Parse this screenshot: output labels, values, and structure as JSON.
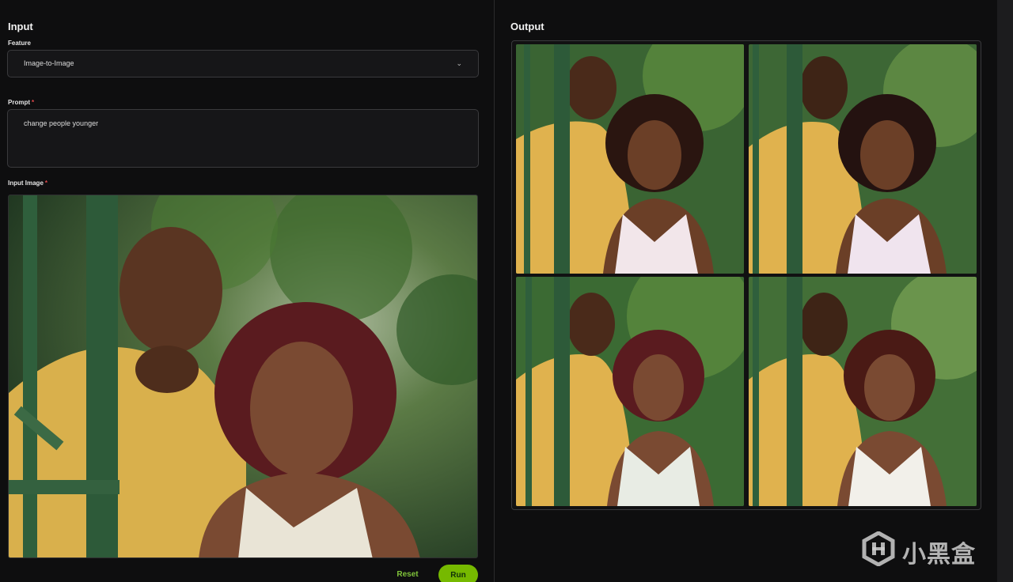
{
  "input": {
    "title": "Input",
    "feature": {
      "label": "Feature",
      "value": "Image-to-Image"
    },
    "prompt": {
      "label": "Prompt",
      "required_mark": "*",
      "value": "change people younger"
    },
    "input_image": {
      "label": "Input Image",
      "required_mark": "*"
    },
    "buttons": {
      "reset": "Reset",
      "run": "Run"
    }
  },
  "output": {
    "title": "Output",
    "image_count": 4
  },
  "watermark": {
    "text": "小黑盒"
  },
  "colors": {
    "accent": "#76b900",
    "required": "#e0484a",
    "background": "#0e0e0f"
  },
  "icons": {
    "select": "chevron-down-icon",
    "watermark": "h-logo-icon"
  }
}
